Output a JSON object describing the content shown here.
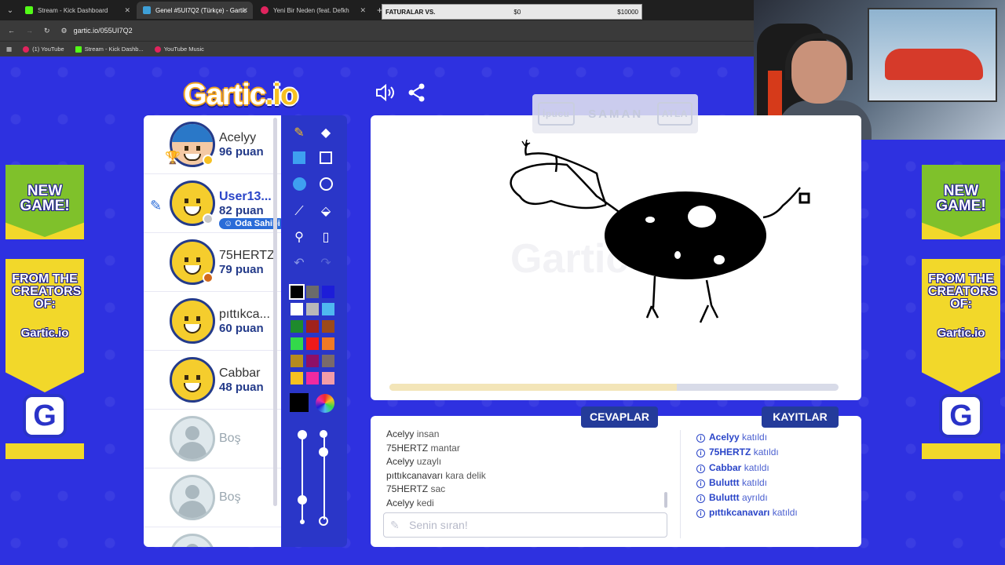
{
  "browser": {
    "tabs": [
      {
        "title": "Stream - Kick Dashboard",
        "favicon_color": "#53fc18"
      },
      {
        "title": "Genel #5UI7Q2 (Türkçe) - Gartic",
        "favicon_color": "#3ea0d8"
      },
      {
        "title": "Yeni Bir Neden (feat. Defkh",
        "favicon_color": "#e0245e"
      }
    ],
    "url": "gartic.io/055UI7Q2",
    "bookmarks": [
      {
        "label": "(1) YouTube",
        "color": "#e0245e"
      },
      {
        "label": "Stream - Kick Dashb...",
        "color": "#53fc18"
      },
      {
        "label": "YouTube Music",
        "color": "#e0245e"
      }
    ]
  },
  "widget": {
    "label": "FATURALAR VS.",
    "current": "$0",
    "goal": "$10000"
  },
  "ads": {
    "new_game": "NEW GAME!",
    "from": "FROM THE CREATORS OF:",
    "brand": "Gartic.io"
  },
  "header": {
    "logo_main": "Gartic",
    "logo_suffix": ".io",
    "sound_icon": "speaker-icon",
    "share_icon": "share-icon"
  },
  "players": [
    {
      "name": "Acelyy",
      "score": "96 puan",
      "avatar": "girl",
      "status_color": "#f6c021"
    },
    {
      "name": "User13...",
      "score": "82 puan",
      "avatar": "smiley",
      "status_color": "#c8c8c8",
      "owner_label": "Oda Sahibi",
      "drawing": true
    },
    {
      "name": "75HERTZ",
      "score": "79 puan",
      "avatar": "smiley",
      "status_color": "#d26a1c"
    },
    {
      "name": "pıttıkca...",
      "score": "60 puan",
      "avatar": "smiley"
    },
    {
      "name": "Cabbar",
      "score": "48 puan",
      "avatar": "smiley"
    },
    {
      "name": "Boş",
      "avatar": "empty"
    },
    {
      "name": "Boş",
      "avatar": "empty"
    }
  ],
  "palette": [
    "#000000",
    "#6b6b6b",
    "#1d1dd8",
    "#ffffff",
    "#b8b8b8",
    "#4fb8f0",
    "#1e8a2c",
    "#a1221c",
    "#9c4a1a",
    "#33d94a",
    "#f01a1a",
    "#f07a24",
    "#b58a1e",
    "#8e1066",
    "#7a6a6a",
    "#f6c021",
    "#f02aa0",
    "#f29ca8"
  ],
  "hint": {
    "hint_label": "İpucu",
    "word": "SAMAN",
    "skip_label": "ATLA"
  },
  "progress": 0.64,
  "tabs": {
    "answers": "CEVAPLAR",
    "logs": "KAYITLAR"
  },
  "answers": [
    {
      "user": "Acelyy",
      "text": "insan"
    },
    {
      "user": "75HERTZ",
      "text": "mantar"
    },
    {
      "user": "Acelyy",
      "text": "uzaylı"
    },
    {
      "user": "pıttıkcanavarı",
      "text": "kara delik"
    },
    {
      "user": "75HERTZ",
      "text": "sac"
    },
    {
      "user": "Acelyy",
      "text": "kedi"
    }
  ],
  "input_placeholder": "Senin sıran!",
  "logs": [
    {
      "user": "Acelyy",
      "event": "katıldı"
    },
    {
      "user": "75HERTZ",
      "event": "katıldı"
    },
    {
      "user": "Cabbar",
      "event": "katıldı"
    },
    {
      "user": "Buluttt",
      "event": "katıldı"
    },
    {
      "user": "Buluttt",
      "event": "ayrıldı"
    },
    {
      "user": "pıttıkcanavarı",
      "event": "katıldı"
    }
  ]
}
